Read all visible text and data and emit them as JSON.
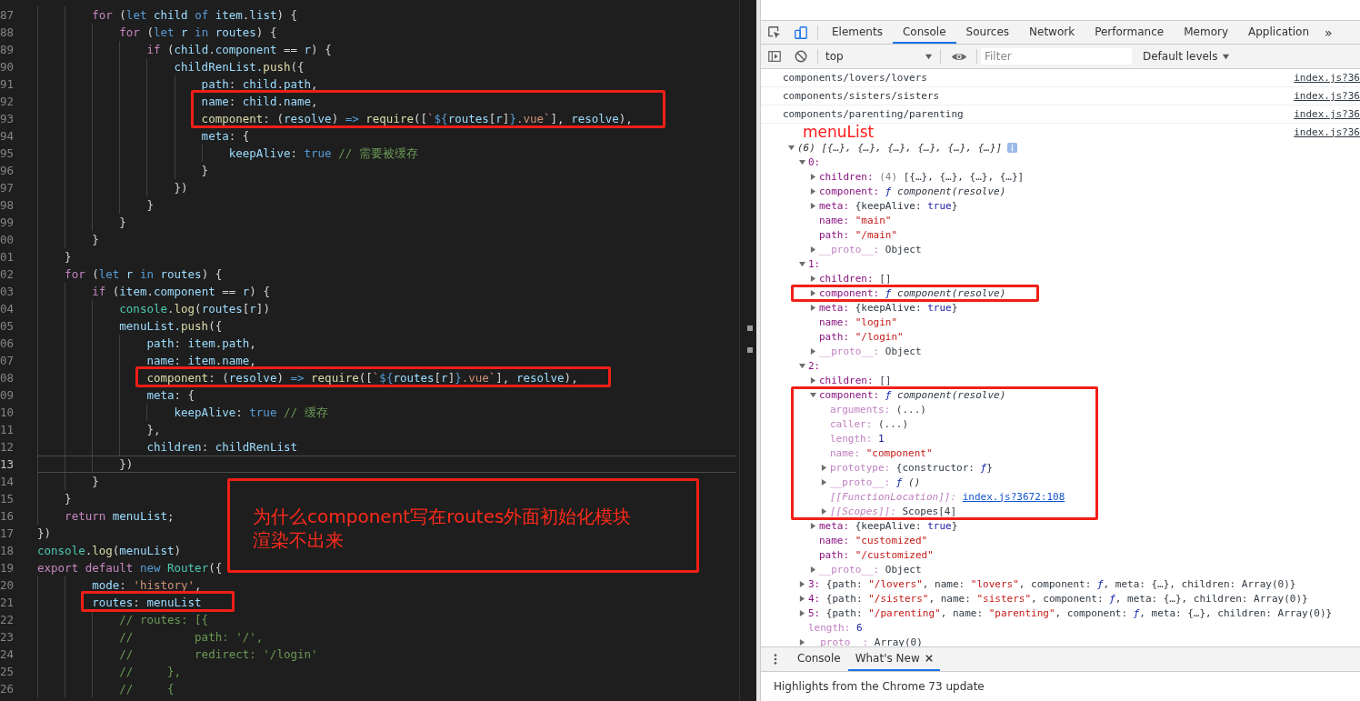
{
  "editor": {
    "lines": [
      {
        "number": "87",
        "current": false,
        "marked": false,
        "tokens": [
          {
            "kind": "kw",
            "text": "        for"
          },
          {
            "kind": "pl",
            "text": " ("
          },
          {
            "kind": "st",
            "text": "let"
          },
          {
            "kind": "var",
            "text": " child "
          },
          {
            "kind": "st",
            "text": "of"
          },
          {
            "kind": "var",
            "text": " item"
          },
          {
            "kind": "pl",
            "text": "."
          },
          {
            "kind": "var",
            "text": "list"
          },
          {
            "kind": "pl",
            "text": ") {"
          }
        ]
      },
      {
        "number": "88",
        "current": false,
        "marked": false,
        "tokens": [
          {
            "kind": "kw",
            "text": "            for"
          },
          {
            "kind": "pl",
            "text": " ("
          },
          {
            "kind": "st",
            "text": "let"
          },
          {
            "kind": "var",
            "text": " r "
          },
          {
            "kind": "st",
            "text": "in"
          },
          {
            "kind": "var",
            "text": " routes"
          },
          {
            "kind": "pl",
            "text": ") {"
          }
        ]
      },
      {
        "number": "89",
        "current": false,
        "marked": false,
        "tokens": [
          {
            "kind": "kw",
            "text": "                if"
          },
          {
            "kind": "pl",
            "text": " ("
          },
          {
            "kind": "var",
            "text": "child"
          },
          {
            "kind": "pl",
            "text": "."
          },
          {
            "kind": "var",
            "text": "component"
          },
          {
            "kind": "pl",
            "text": " == "
          },
          {
            "kind": "var",
            "text": "r"
          },
          {
            "kind": "pl",
            "text": ") {"
          }
        ]
      },
      {
        "number": "90",
        "current": false,
        "marked": false,
        "tokens": [
          {
            "kind": "var",
            "text": "                    childRenList."
          },
          {
            "kind": "fn",
            "text": "push"
          },
          {
            "kind": "pl",
            "text": "({"
          }
        ]
      },
      {
        "number": "91",
        "current": false,
        "marked": false,
        "tokens": [
          {
            "kind": "var",
            "text": "                        path"
          },
          {
            "kind": "pl",
            "text": ": "
          },
          {
            "kind": "var",
            "text": "child"
          },
          {
            "kind": "pl",
            "text": "."
          },
          {
            "kind": "var",
            "text": "path"
          },
          {
            "kind": "pl",
            "text": ","
          }
        ]
      },
      {
        "number": "92",
        "current": false,
        "marked": true,
        "tokens": [
          {
            "kind": "var",
            "text": "                        name"
          },
          {
            "kind": "pl",
            "text": ": "
          },
          {
            "kind": "var",
            "text": "child"
          },
          {
            "kind": "pl",
            "text": "."
          },
          {
            "kind": "var",
            "text": "name"
          },
          {
            "kind": "pl",
            "text": ","
          }
        ]
      },
      {
        "number": "93",
        "current": false,
        "marked": true,
        "tokens": [
          {
            "kind": "fn",
            "text": "                        component"
          },
          {
            "kind": "pl",
            "text": ": ("
          },
          {
            "kind": "var",
            "text": "resolve"
          },
          {
            "kind": "pl",
            "text": ") "
          },
          {
            "kind": "st",
            "text": "=>"
          },
          {
            "kind": "fn",
            "text": " require"
          },
          {
            "kind": "pl",
            "text": "(["
          },
          {
            "kind": "str",
            "text": "`"
          },
          {
            "kind": "st",
            "text": "${"
          },
          {
            "kind": "var",
            "text": "routes"
          },
          {
            "kind": "pl",
            "text": "["
          },
          {
            "kind": "var",
            "text": "r"
          },
          {
            "kind": "pl",
            "text": "]"
          },
          {
            "kind": "st",
            "text": "}"
          },
          {
            "kind": "str",
            "text": ".vue`"
          },
          {
            "kind": "pl",
            "text": "], "
          },
          {
            "kind": "var",
            "text": "resolve"
          },
          {
            "kind": "pl",
            "text": "),"
          }
        ]
      },
      {
        "number": "94",
        "current": false,
        "marked": false,
        "tokens": [
          {
            "kind": "var",
            "text": "                        meta"
          },
          {
            "kind": "pl",
            "text": ": {"
          }
        ]
      },
      {
        "number": "95",
        "current": false,
        "marked": false,
        "tokens": [
          {
            "kind": "var",
            "text": "                            keepAlive"
          },
          {
            "kind": "pl",
            "text": ": "
          },
          {
            "kind": "st",
            "text": "true"
          },
          {
            "kind": "cm",
            "text": " // 需要被缓存"
          }
        ]
      },
      {
        "number": "96",
        "current": false,
        "marked": false,
        "tokens": [
          {
            "kind": "pl",
            "text": "                        }"
          }
        ]
      },
      {
        "number": "97",
        "current": false,
        "marked": false,
        "tokens": [
          {
            "kind": "pl",
            "text": "                    })"
          }
        ]
      },
      {
        "number": "98",
        "current": false,
        "marked": false,
        "tokens": [
          {
            "kind": "pl",
            "text": "                }"
          }
        ]
      },
      {
        "number": "99",
        "current": false,
        "marked": false,
        "tokens": [
          {
            "kind": "pl",
            "text": "            }"
          }
        ]
      },
      {
        "number": "00",
        "current": false,
        "marked": false,
        "tokens": [
          {
            "kind": "pl",
            "text": "        }"
          }
        ]
      },
      {
        "number": "01",
        "current": false,
        "marked": false,
        "tokens": [
          {
            "kind": "pl",
            "text": "    }"
          }
        ]
      },
      {
        "number": "02",
        "current": false,
        "marked": false,
        "tokens": [
          {
            "kind": "kw",
            "text": "    for"
          },
          {
            "kind": "pl",
            "text": " ("
          },
          {
            "kind": "st",
            "text": "let"
          },
          {
            "kind": "var",
            "text": " r "
          },
          {
            "kind": "st",
            "text": "in"
          },
          {
            "kind": "var",
            "text": " routes"
          },
          {
            "kind": "pl",
            "text": ") {"
          }
        ]
      },
      {
        "number": "03",
        "current": false,
        "marked": false,
        "tokens": [
          {
            "kind": "kw",
            "text": "        if"
          },
          {
            "kind": "pl",
            "text": " ("
          },
          {
            "kind": "var",
            "text": "item"
          },
          {
            "kind": "pl",
            "text": "."
          },
          {
            "kind": "var",
            "text": "component"
          },
          {
            "kind": "pl",
            "text": " == "
          },
          {
            "kind": "var",
            "text": "r"
          },
          {
            "kind": "pl",
            "text": ") {"
          }
        ]
      },
      {
        "number": "04",
        "current": false,
        "marked": false,
        "tokens": [
          {
            "kind": "cls",
            "text": "            console"
          },
          {
            "kind": "pl",
            "text": "."
          },
          {
            "kind": "fn",
            "text": "log"
          },
          {
            "kind": "pl",
            "text": "("
          },
          {
            "kind": "var",
            "text": "routes"
          },
          {
            "kind": "pl",
            "text": "["
          },
          {
            "kind": "var",
            "text": "r"
          },
          {
            "kind": "pl",
            "text": "])"
          }
        ]
      },
      {
        "number": "05",
        "current": false,
        "marked": false,
        "tokens": [
          {
            "kind": "var",
            "text": "            menuList."
          },
          {
            "kind": "fn",
            "text": "push"
          },
          {
            "kind": "pl",
            "text": "({"
          }
        ]
      },
      {
        "number": "06",
        "current": false,
        "marked": false,
        "tokens": [
          {
            "kind": "var",
            "text": "                path"
          },
          {
            "kind": "pl",
            "text": ": "
          },
          {
            "kind": "var",
            "text": "item"
          },
          {
            "kind": "pl",
            "text": "."
          },
          {
            "kind": "var",
            "text": "path"
          },
          {
            "kind": "pl",
            "text": ","
          }
        ]
      },
      {
        "number": "07",
        "current": false,
        "marked": false,
        "tokens": [
          {
            "kind": "var",
            "text": "                name"
          },
          {
            "kind": "pl",
            "text": ": "
          },
          {
            "kind": "var",
            "text": "item"
          },
          {
            "kind": "pl",
            "text": "."
          },
          {
            "kind": "var",
            "text": "name"
          },
          {
            "kind": "pl",
            "text": ","
          }
        ]
      },
      {
        "number": "08",
        "current": false,
        "marked": true,
        "tokens": [
          {
            "kind": "fn",
            "text": "                component"
          },
          {
            "kind": "pl",
            "text": ": ("
          },
          {
            "kind": "var",
            "text": "resolve"
          },
          {
            "kind": "pl",
            "text": ") "
          },
          {
            "kind": "st",
            "text": "=>"
          },
          {
            "kind": "fn",
            "text": " require"
          },
          {
            "kind": "pl",
            "text": "(["
          },
          {
            "kind": "str",
            "text": "`"
          },
          {
            "kind": "st",
            "text": "${"
          },
          {
            "kind": "var",
            "text": "routes"
          },
          {
            "kind": "pl",
            "text": "["
          },
          {
            "kind": "var",
            "text": "r"
          },
          {
            "kind": "pl",
            "text": "]"
          },
          {
            "kind": "st",
            "text": "}"
          },
          {
            "kind": "str",
            "text": ".vue`"
          },
          {
            "kind": "pl",
            "text": "], "
          },
          {
            "kind": "var",
            "text": "resolve"
          },
          {
            "kind": "pl",
            "text": "),"
          }
        ]
      },
      {
        "number": "09",
        "current": false,
        "marked": false,
        "tokens": [
          {
            "kind": "var",
            "text": "                meta"
          },
          {
            "kind": "pl",
            "text": ": {"
          }
        ]
      },
      {
        "number": "10",
        "current": false,
        "marked": false,
        "tokens": [
          {
            "kind": "var",
            "text": "                    keepAlive"
          },
          {
            "kind": "pl",
            "text": ": "
          },
          {
            "kind": "st",
            "text": "true"
          },
          {
            "kind": "cm",
            "text": " // 缓存"
          }
        ]
      },
      {
        "number": "11",
        "current": false,
        "marked": false,
        "tokens": [
          {
            "kind": "pl",
            "text": "                },"
          }
        ]
      },
      {
        "number": "12",
        "current": false,
        "marked": false,
        "tokens": [
          {
            "kind": "var",
            "text": "                children"
          },
          {
            "kind": "pl",
            "text": ": "
          },
          {
            "kind": "var",
            "text": "childRenList"
          }
        ]
      },
      {
        "number": "13",
        "current": true,
        "marked": false,
        "tokens": [
          {
            "kind": "pl",
            "text": "            })"
          }
        ]
      },
      {
        "number": "14",
        "current": false,
        "marked": false,
        "tokens": [
          {
            "kind": "pl",
            "text": "        }"
          }
        ]
      },
      {
        "number": "15",
        "current": false,
        "marked": false,
        "tokens": [
          {
            "kind": "pl",
            "text": "    }"
          }
        ]
      },
      {
        "number": "16",
        "current": false,
        "marked": false,
        "tokens": [
          {
            "kind": "kw",
            "text": "    return"
          },
          {
            "kind": "var",
            "text": " menuList"
          },
          {
            "kind": "pl",
            "text": ";"
          }
        ]
      },
      {
        "number": "17",
        "current": false,
        "marked": false,
        "tokens": [
          {
            "kind": "pl",
            "text": "})"
          }
        ]
      },
      {
        "number": "18",
        "current": false,
        "marked": false,
        "tokens": [
          {
            "kind": "cls",
            "text": "console"
          },
          {
            "kind": "pl",
            "text": "."
          },
          {
            "kind": "fn",
            "text": "log"
          },
          {
            "kind": "pl",
            "text": "("
          },
          {
            "kind": "var",
            "text": "menuList"
          },
          {
            "kind": "pl",
            "text": ")"
          }
        ]
      },
      {
        "number": "19",
        "current": false,
        "marked": false,
        "tokens": [
          {
            "kind": "kw",
            "text": "export"
          },
          {
            "kind": "kw",
            "text": " default"
          },
          {
            "kind": "st",
            "text": " new"
          },
          {
            "kind": "cls",
            "text": " Router"
          },
          {
            "kind": "pl",
            "text": "({"
          }
        ]
      },
      {
        "number": "20",
        "current": false,
        "marked": false,
        "tokens": [
          {
            "kind": "var",
            "text": "        mode"
          },
          {
            "kind": "pl",
            "text": ": "
          },
          {
            "kind": "str",
            "text": "'history'"
          },
          {
            "kind": "pl",
            "text": ","
          }
        ]
      },
      {
        "number": "21",
        "current": false,
        "marked": true,
        "tokens": [
          {
            "kind": "var",
            "text": "        routes"
          },
          {
            "kind": "pl",
            "text": ": "
          },
          {
            "kind": "var",
            "text": "menuList"
          }
        ]
      },
      {
        "number": "22",
        "current": false,
        "marked": false,
        "tokens": [
          {
            "kind": "cm",
            "text": "            // routes: [{"
          }
        ]
      },
      {
        "number": "23",
        "current": false,
        "marked": false,
        "tokens": [
          {
            "kind": "cm",
            "text": "            //         path: '/',"
          }
        ]
      },
      {
        "number": "24",
        "current": false,
        "marked": false,
        "tokens": [
          {
            "kind": "cm",
            "text": "            //         redirect: '/login'"
          }
        ]
      },
      {
        "number": "25",
        "current": false,
        "marked": false,
        "tokens": [
          {
            "kind": "cm",
            "text": "            //     },"
          }
        ]
      },
      {
        "number": "26",
        "current": false,
        "marked": false,
        "tokens": [
          {
            "kind": "cm",
            "text": "            //     {"
          }
        ]
      }
    ],
    "note": "为什么component写在routes外面初始化模块渲染不出来"
  },
  "devtools": {
    "tabs": [
      {
        "label": "Elements",
        "selected": false
      },
      {
        "label": "Console",
        "selected": true
      },
      {
        "label": "Sources",
        "selected": false
      },
      {
        "label": "Network",
        "selected": false
      },
      {
        "label": "Performance",
        "selected": false
      },
      {
        "label": "Memory",
        "selected": false
      },
      {
        "label": "Application",
        "selected": false
      }
    ],
    "more_tabs": "»",
    "context": "top",
    "filter": {
      "placeholder": "Filter"
    },
    "levels": "Default levels"
  },
  "console": {
    "messages": [
      {
        "text": "components/lovers/lovers",
        "source": "index.js?36"
      },
      {
        "text": "components/sisters/sisters",
        "source": "index.js?36"
      },
      {
        "text": "components/parenting/parenting",
        "source": "index.js?36"
      },
      {
        "note": "menuList",
        "source": "index.js?36",
        "tree": {
          "parts": [
            {
              "kind": "preview",
              "text": "(6) [{…}, {…}, {…}, {…}, {…}, {…}]"
            }
          ],
          "expanded": true,
          "marked": false,
          "children": [
            {
              "key": "0:",
              "kind": "own",
              "expanded": true,
              "marked": false,
              "children": [
                {
                  "key": "children:",
                  "kind": "own",
                  "parts": [
                    {
                      "kind": "gray",
                      "text": "(4)"
                    },
                    {
                      "kind": "plain",
                      "text": " [{…}, {…}, {…}, {…}]"
                    }
                  ],
                  "expanded": false,
                  "marked": false
                },
                {
                  "key": "component:",
                  "kind": "own",
                  "parts": [
                    {
                      "kind": "fsign",
                      "text": "ƒ"
                    },
                    {
                      "kind": "func",
                      "text": " component(resolve)"
                    }
                  ],
                  "expanded": false,
                  "marked": false
                },
                {
                  "key": "meta:",
                  "kind": "own",
                  "parts": [
                    {
                      "kind": "plain",
                      "text": "{keepAlive: "
                    },
                    {
                      "kind": "number",
                      "text": "true"
                    },
                    {
                      "kind": "plain",
                      "text": "}"
                    }
                  ],
                  "expanded": false,
                  "marked": false
                },
                {
                  "key": "name:",
                  "kind": "own",
                  "parts": [
                    {
                      "kind": "string",
                      "text": "\"main\""
                    }
                  ],
                  "marked": false
                },
                {
                  "key": "path:",
                  "kind": "own",
                  "parts": [
                    {
                      "kind": "string",
                      "text": "\"/main\""
                    }
                  ],
                  "marked": false
                },
                {
                  "key": "__proto__:",
                  "kind": "inner",
                  "parts": [
                    {
                      "kind": "plain",
                      "text": "Object"
                    }
                  ],
                  "expanded": false,
                  "marked": false
                }
              ]
            },
            {
              "key": "1:",
              "kind": "own",
              "expanded": true,
              "marked": false,
              "children": [
                {
                  "key": "children:",
                  "kind": "own",
                  "parts": [
                    {
                      "kind": "plain",
                      "text": "[]"
                    }
                  ],
                  "expanded": false,
                  "marked": false
                },
                {
                  "key": "component:",
                  "kind": "own",
                  "parts": [
                    {
                      "kind": "fsign",
                      "text": "ƒ"
                    },
                    {
                      "kind": "func",
                      "text": " component(resolve)"
                    }
                  ],
                  "expanded": false,
                  "marked": true
                },
                {
                  "key": "meta:",
                  "kind": "own",
                  "parts": [
                    {
                      "kind": "plain",
                      "text": "{keepAlive: "
                    },
                    {
                      "kind": "number",
                      "text": "true"
                    },
                    {
                      "kind": "plain",
                      "text": "}"
                    }
                  ],
                  "expanded": false,
                  "marked": false
                },
                {
                  "key": "name:",
                  "kind": "own",
                  "parts": [
                    {
                      "kind": "string",
                      "text": "\"login\""
                    }
                  ],
                  "marked": false
                },
                {
                  "key": "path:",
                  "kind": "own",
                  "parts": [
                    {
                      "kind": "string",
                      "text": "\"/login\""
                    }
                  ],
                  "marked": false
                },
                {
                  "key": "__proto__:",
                  "kind": "inner",
                  "parts": [
                    {
                      "kind": "plain",
                      "text": "Object"
                    }
                  ],
                  "expanded": false,
                  "marked": false
                }
              ]
            },
            {
              "key": "2:",
              "kind": "own",
              "expanded": true,
              "marked": false,
              "children": [
                {
                  "key": "children:",
                  "kind": "own",
                  "parts": [
                    {
                      "kind": "plain",
                      "text": "[]"
                    }
                  ],
                  "expanded": false,
                  "marked": false
                },
                {
                  "key": "component:",
                  "kind": "own",
                  "parts": [
                    {
                      "kind": "fsign",
                      "text": "ƒ"
                    },
                    {
                      "kind": "func",
                      "text": " component(resolve)"
                    }
                  ],
                  "expanded": true,
                  "marked": true,
                  "children": [
                    {
                      "key": "arguments:",
                      "kind": "inner",
                      "parts": [
                        {
                          "kind": "plain",
                          "text": "(...)"
                        }
                      ],
                      "marked": false
                    },
                    {
                      "key": "caller:",
                      "kind": "inner",
                      "parts": [
                        {
                          "kind": "plain",
                          "text": "(...)"
                        }
                      ],
                      "marked": false
                    },
                    {
                      "key": "length:",
                      "kind": "inner",
                      "parts": [
                        {
                          "kind": "number",
                          "text": "1"
                        }
                      ],
                      "marked": false
                    },
                    {
                      "key": "name:",
                      "kind": "inner",
                      "parts": [
                        {
                          "kind": "string",
                          "text": "\"component\""
                        }
                      ],
                      "marked": false
                    },
                    {
                      "key": "prototype:",
                      "kind": "inner",
                      "parts": [
                        {
                          "kind": "plain",
                          "text": "{constructor: "
                        },
                        {
                          "kind": "fsign",
                          "text": "ƒ"
                        },
                        {
                          "kind": "plain",
                          "text": "}"
                        }
                      ],
                      "expanded": false,
                      "marked": false
                    },
                    {
                      "key": "__proto__:",
                      "kind": "inner",
                      "parts": [
                        {
                          "kind": "fsign",
                          "text": "ƒ"
                        },
                        {
                          "kind": "func",
                          "text": " ()"
                        }
                      ],
                      "expanded": false,
                      "marked": false
                    },
                    {
                      "key": "[[FunctionLocation]]:",
                      "kind": "internal",
                      "parts": [
                        {
                          "kind": "link",
                          "text": "index.js?3672:108"
                        }
                      ],
                      "marked": false
                    },
                    {
                      "key": "[[Scopes]]:",
                      "kind": "internal",
                      "parts": [
                        {
                          "kind": "plain",
                          "text": "Scopes[4]"
                        }
                      ],
                      "expanded": false,
                      "marked": false
                    }
                  ]
                },
                {
                  "key": "meta:",
                  "kind": "own",
                  "parts": [
                    {
                      "kind": "plain",
                      "text": "{keepAlive: "
                    },
                    {
                      "kind": "number",
                      "text": "true"
                    },
                    {
                      "kind": "plain",
                      "text": "}"
                    }
                  ],
                  "expanded": false,
                  "marked": false
                },
                {
                  "key": "name:",
                  "kind": "own",
                  "parts": [
                    {
                      "kind": "string",
                      "text": "\"customized\""
                    }
                  ],
                  "marked": false
                },
                {
                  "key": "path:",
                  "kind": "own",
                  "parts": [
                    {
                      "kind": "string",
                      "text": "\"/customized\""
                    }
                  ],
                  "marked": false
                },
                {
                  "key": "__proto__:",
                  "kind": "inner",
                  "parts": [
                    {
                      "kind": "plain",
                      "text": "Object"
                    }
                  ],
                  "expanded": false,
                  "marked": false
                }
              ]
            },
            {
              "key": "3:",
              "kind": "own",
              "parts": [
                {
                  "kind": "plain",
                  "text": "{path: "
                },
                {
                  "kind": "string",
                  "text": "\"/lovers\""
                },
                {
                  "kind": "plain",
                  "text": ", name: "
                },
                {
                  "kind": "string",
                  "text": "\"lovers\""
                },
                {
                  "kind": "plain",
                  "text": ", component: "
                },
                {
                  "kind": "fsign",
                  "text": "ƒ"
                },
                {
                  "kind": "plain",
                  "text": ", meta: {…}, children: Array(0)}"
                }
              ],
              "expanded": false,
              "marked": false
            },
            {
              "key": "4:",
              "kind": "own",
              "parts": [
                {
                  "kind": "plain",
                  "text": "{path: "
                },
                {
                  "kind": "string",
                  "text": "\"/sisters\""
                },
                {
                  "kind": "plain",
                  "text": ", name: "
                },
                {
                  "kind": "string",
                  "text": "\"sisters\""
                },
                {
                  "kind": "plain",
                  "text": ", component: "
                },
                {
                  "kind": "fsign",
                  "text": "ƒ"
                },
                {
                  "kind": "plain",
                  "text": ", meta: {…}, children: Array(0)}"
                }
              ],
              "expanded": false,
              "marked": false
            },
            {
              "key": "5:",
              "kind": "own",
              "parts": [
                {
                  "kind": "plain",
                  "text": "{path: "
                },
                {
                  "kind": "string",
                  "text": "\"/parenting\""
                },
                {
                  "kind": "plain",
                  "text": ", name: "
                },
                {
                  "kind": "string",
                  "text": "\"parenting\""
                },
                {
                  "kind": "plain",
                  "text": ", component: "
                },
                {
                  "kind": "fsign",
                  "text": "ƒ"
                },
                {
                  "kind": "plain",
                  "text": ", meta: {…}, children: Array(0)}"
                }
              ],
              "expanded": false,
              "marked": false
            },
            {
              "key": "length:",
              "kind": "inner",
              "parts": [
                {
                  "kind": "number",
                  "text": "6"
                }
              ],
              "marked": false
            },
            {
              "key": "__proto__:",
              "kind": "inner",
              "parts": [
                {
                  "kind": "plain",
                  "text": "Array(0)"
                }
              ],
              "expanded": false,
              "marked": false
            }
          ]
        }
      }
    ]
  },
  "drawer": {
    "tabs": [
      {
        "label": "Console",
        "selected": false,
        "closable": false
      },
      {
        "label": "What's New",
        "selected": true,
        "closable": true
      }
    ],
    "message": "Highlights from the Chrome 73 update"
  }
}
